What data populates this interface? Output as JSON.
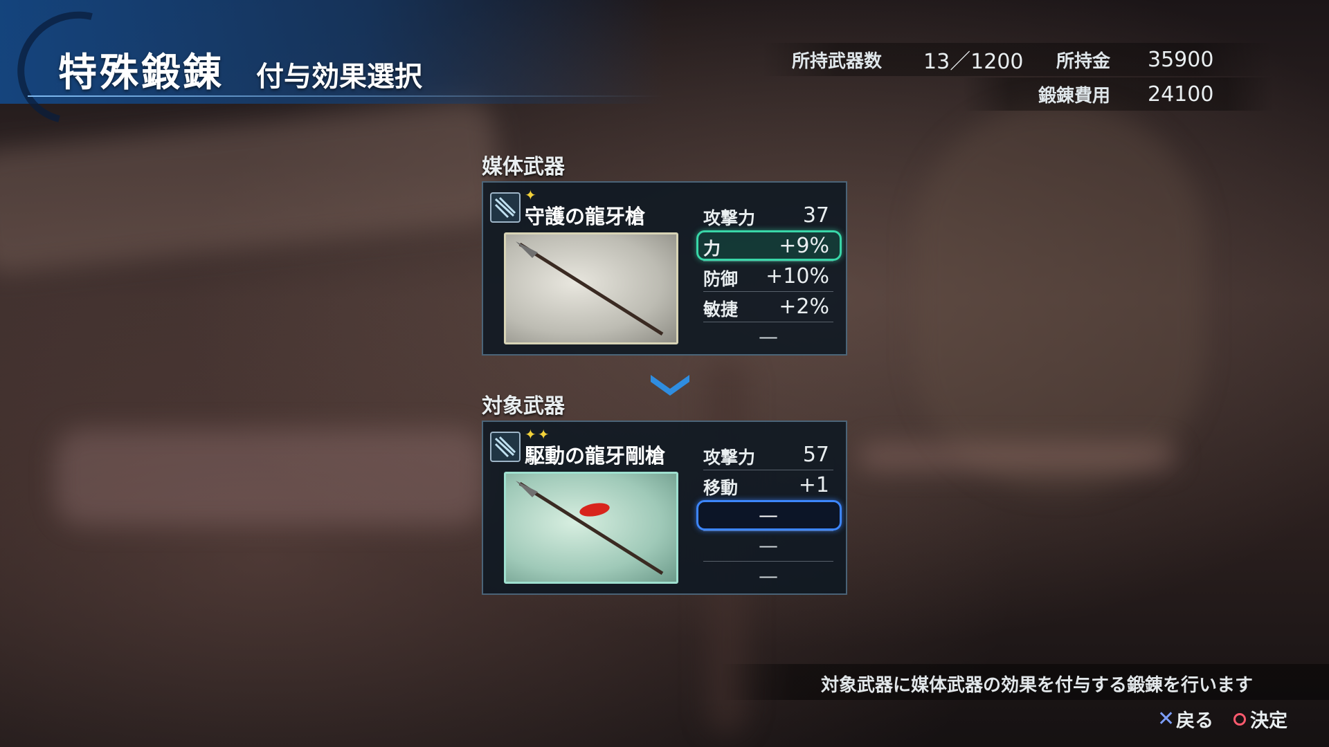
{
  "header": {
    "title": "特殊鍛錬",
    "subtitle": "付与効果選択"
  },
  "stats": {
    "weapons_label": "所持武器数",
    "weapons_value": "13／1200",
    "money_label": "所持金",
    "money_value": "35900",
    "cost_label": "鍛錬費用",
    "cost_value": "24100"
  },
  "source_weapon": {
    "section_label": "媒体武器",
    "name": "守護の龍牙槍",
    "stars": "✦",
    "icon": "spear-type-icon",
    "rows": [
      {
        "name": "攻撃力",
        "value": "37"
      },
      {
        "name": "力",
        "value": "+9%"
      },
      {
        "name": "防御",
        "value": "+10%"
      },
      {
        "name": "敏捷",
        "value": "+2%"
      },
      {
        "name": "",
        "value": "—"
      }
    ]
  },
  "target_weapon": {
    "section_label": "対象武器",
    "name": "駆動の龍牙剛槍",
    "stars": "✦✦",
    "icon": "spear-type-icon",
    "rows": [
      {
        "name": "攻撃力",
        "value": "57"
      },
      {
        "name": "移動",
        "value": "+1"
      },
      {
        "name": "",
        "value": "—"
      },
      {
        "name": "",
        "value": "—"
      },
      {
        "name": "",
        "value": "—"
      }
    ]
  },
  "footer": {
    "help_text": "対象武器に媒体武器の効果を付与する鍛錬を行います",
    "back_label": "戻る",
    "confirm_label": "決定"
  },
  "colors": {
    "selected_source_highlight": "#39d7a8",
    "target_slot_cursor": "#3d86ff",
    "star": "#f2d13a"
  }
}
